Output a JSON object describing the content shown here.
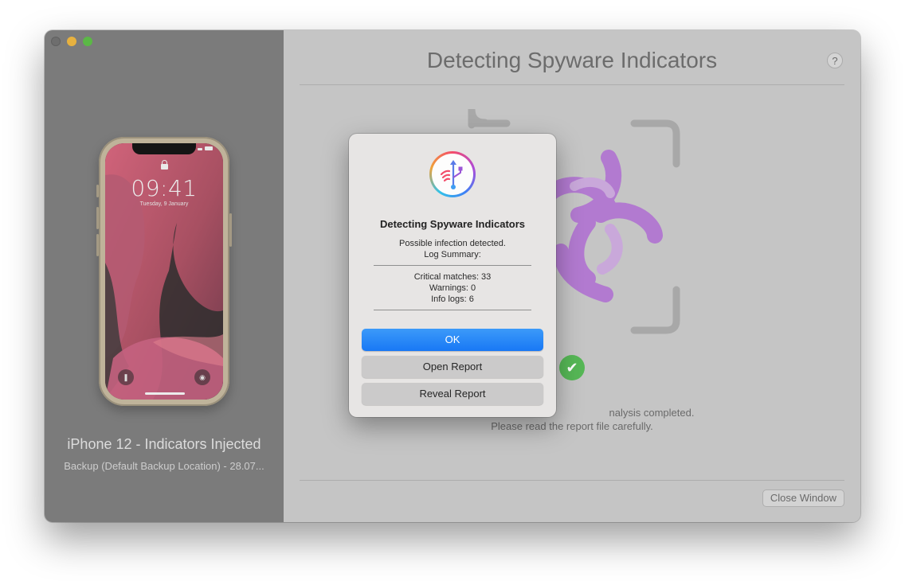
{
  "sidebar": {
    "phone_screen": {
      "time": "09:41",
      "date": "Tuesday, 9 January"
    },
    "device_name": "iPhone 12 - Indicators Injected",
    "device_subtitle": "Backup (Default Backup Location) - 28.07..."
  },
  "main": {
    "title": "Detecting Spyware Indicators",
    "help_label": "?",
    "status_lines": [
      "nalysis completed.",
      "Please read the report file carefully."
    ],
    "close_button": "Close Window"
  },
  "dialog": {
    "title": "Detecting Spyware Indicators",
    "message_line1": "Possible infection detected.",
    "message_line2": "Log Summary:",
    "critical": "Critical matches: 33",
    "warnings": "Warnings: 0",
    "info": "Info logs: 6",
    "ok_button": "OK",
    "open_report_button": "Open Report",
    "reveal_report_button": "Reveal Report"
  },
  "colors": {
    "accent_button": "#1a7cf6",
    "biohazard_purple": "#b27ad0",
    "success_green": "#56b756"
  },
  "icons": [
    "lock-icon",
    "flashlight-icon",
    "camera-icon",
    "help-icon",
    "biohazard-icon",
    "checkmark-icon",
    "usb-app-icon"
  ]
}
